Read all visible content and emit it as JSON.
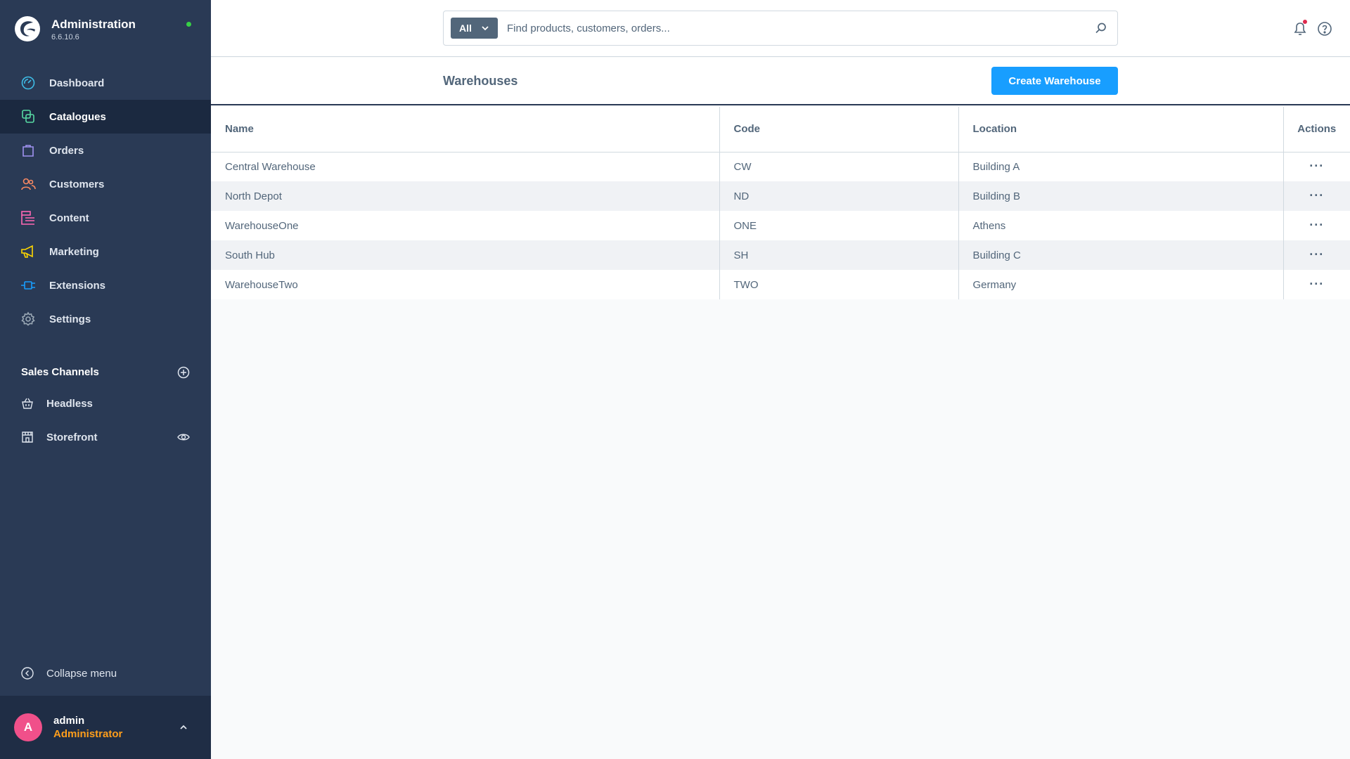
{
  "app": {
    "title": "Administration",
    "version": "6.6.10.6",
    "status_color": "#37d046"
  },
  "sidebar": {
    "items": [
      {
        "label": "Dashboard",
        "icon": "gauge-icon",
        "color": "#3ebce6"
      },
      {
        "label": "Catalogues",
        "icon": "products-icon",
        "color": "#57d9a3",
        "active": true
      },
      {
        "label": "Orders",
        "icon": "shopping-bag-icon",
        "color": "#a092f0"
      },
      {
        "label": "Customers",
        "icon": "users-icon",
        "color": "#f88962"
      },
      {
        "label": "Content",
        "icon": "content-icon",
        "color": "#ff68b4"
      },
      {
        "label": "Marketing",
        "icon": "megaphone-icon",
        "color": "#ffd700"
      },
      {
        "label": "Extensions",
        "icon": "plug-icon",
        "color": "#189eff"
      },
      {
        "label": "Settings",
        "icon": "gear-icon",
        "color": "#9aa8b5"
      }
    ],
    "sales_channels": {
      "title": "Sales Channels",
      "items": [
        {
          "label": "Headless",
          "icon": "basket-icon"
        },
        {
          "label": "Storefront",
          "icon": "storefront-icon"
        }
      ]
    },
    "collapse_label": "Collapse menu"
  },
  "user": {
    "initial": "A",
    "name": "admin",
    "role": "Administrator"
  },
  "search": {
    "type_label": "All",
    "placeholder": "Find products, customers, orders..."
  },
  "page": {
    "title": "Warehouses",
    "create_label": "Create Warehouse"
  },
  "table": {
    "columns": [
      "Name",
      "Code",
      "Location",
      "Actions"
    ],
    "rows": [
      {
        "name": "Central Warehouse",
        "code": "CW",
        "location": "Building A"
      },
      {
        "name": "North Depot",
        "code": "ND",
        "location": "Building B"
      },
      {
        "name": "WarehouseOne",
        "code": "ONE",
        "location": "Athens"
      },
      {
        "name": "South Hub",
        "code": "SH",
        "location": "Building C"
      },
      {
        "name": "WarehouseTwo",
        "code": "TWO",
        "location": "Germany"
      }
    ],
    "row_action": "···"
  }
}
